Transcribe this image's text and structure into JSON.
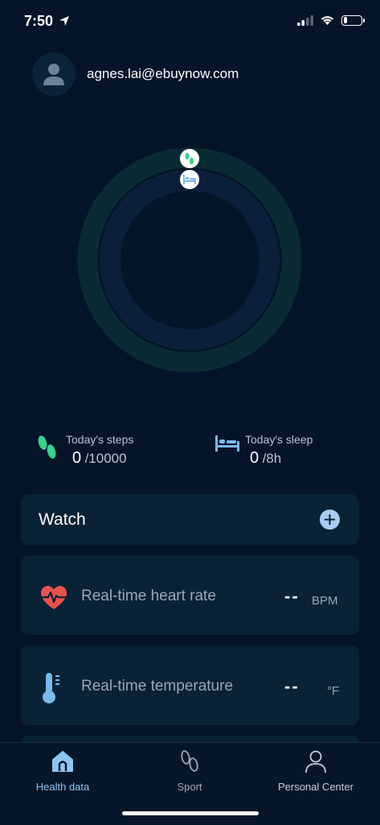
{
  "status_bar": {
    "time": "7:50",
    "battery_percent": 20
  },
  "profile": {
    "email": "agnes.lai@ebuynow.com"
  },
  "ring": {
    "steps_progress": 0,
    "sleep_progress": 0
  },
  "stats": {
    "steps": {
      "label": "Today's steps",
      "value": "0",
      "goal": "/10000"
    },
    "sleep": {
      "label": "Today's sleep",
      "value": "0",
      "goal": "/8h"
    }
  },
  "watch": {
    "title": "Watch"
  },
  "metrics": [
    {
      "label": "Real-time heart rate",
      "value": "--",
      "unit": "BPM"
    },
    {
      "label": "Real-time temperature",
      "value": "--",
      "unit": "°F"
    }
  ],
  "nav": [
    {
      "label": "Health data",
      "active": true
    },
    {
      "label": "Sport",
      "active": false
    },
    {
      "label": "Personal Center",
      "active": false
    }
  ],
  "colors": {
    "background": "#051428",
    "steps_green": "#3ccf8e",
    "sleep_blue": "#7ab8ec",
    "active_nav": "#8cc4f2",
    "heart_red": "#e8524d"
  }
}
